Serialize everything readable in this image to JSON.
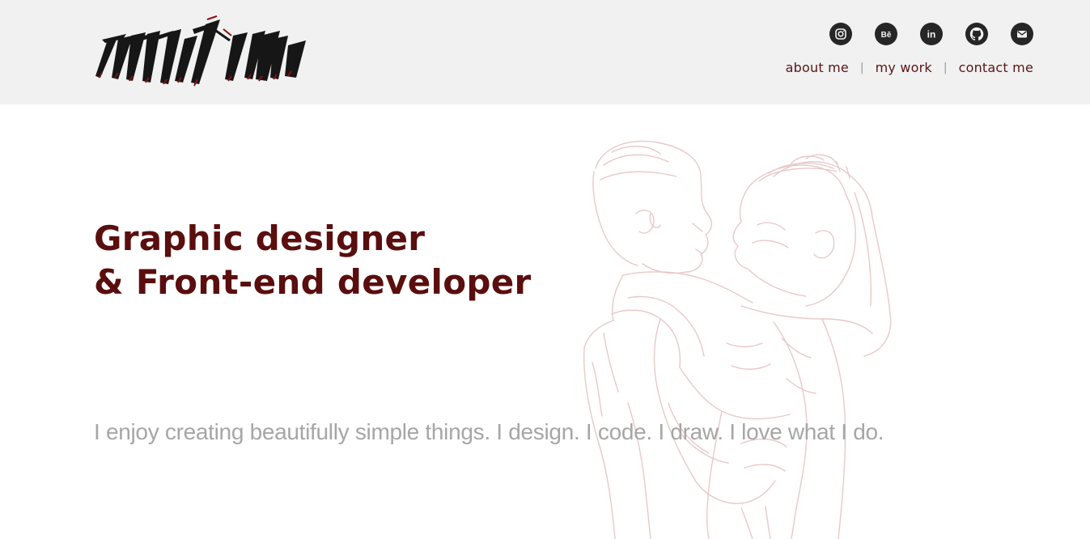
{
  "brand": {
    "logo_text": "milu",
    "logo_icon": "calligraphy-logo"
  },
  "social": [
    {
      "name": "instagram",
      "icon": "instagram-icon"
    },
    {
      "name": "behance",
      "icon": "behance-icon",
      "glyph": "Bē"
    },
    {
      "name": "linkedin",
      "icon": "linkedin-icon",
      "glyph": "in"
    },
    {
      "name": "github",
      "icon": "github-icon"
    },
    {
      "name": "email",
      "icon": "mail-icon"
    }
  ],
  "nav": {
    "items": [
      {
        "label": "about me"
      },
      {
        "label": "my work"
      },
      {
        "label": "contact me"
      }
    ],
    "separator": "|"
  },
  "hero": {
    "headline_line1": "Graphic designer",
    "headline_line2": "& Front-end developer",
    "tagline": "I enjoy creating beautifully simple things. I design. I code. I draw. I love what I do."
  },
  "colors": {
    "header_bg": "#f1f1f1",
    "accent": "#5a0e0e",
    "icon_bg": "#262626",
    "tagline": "#a6a6a6",
    "sketch_line": "#e8c9c9"
  }
}
